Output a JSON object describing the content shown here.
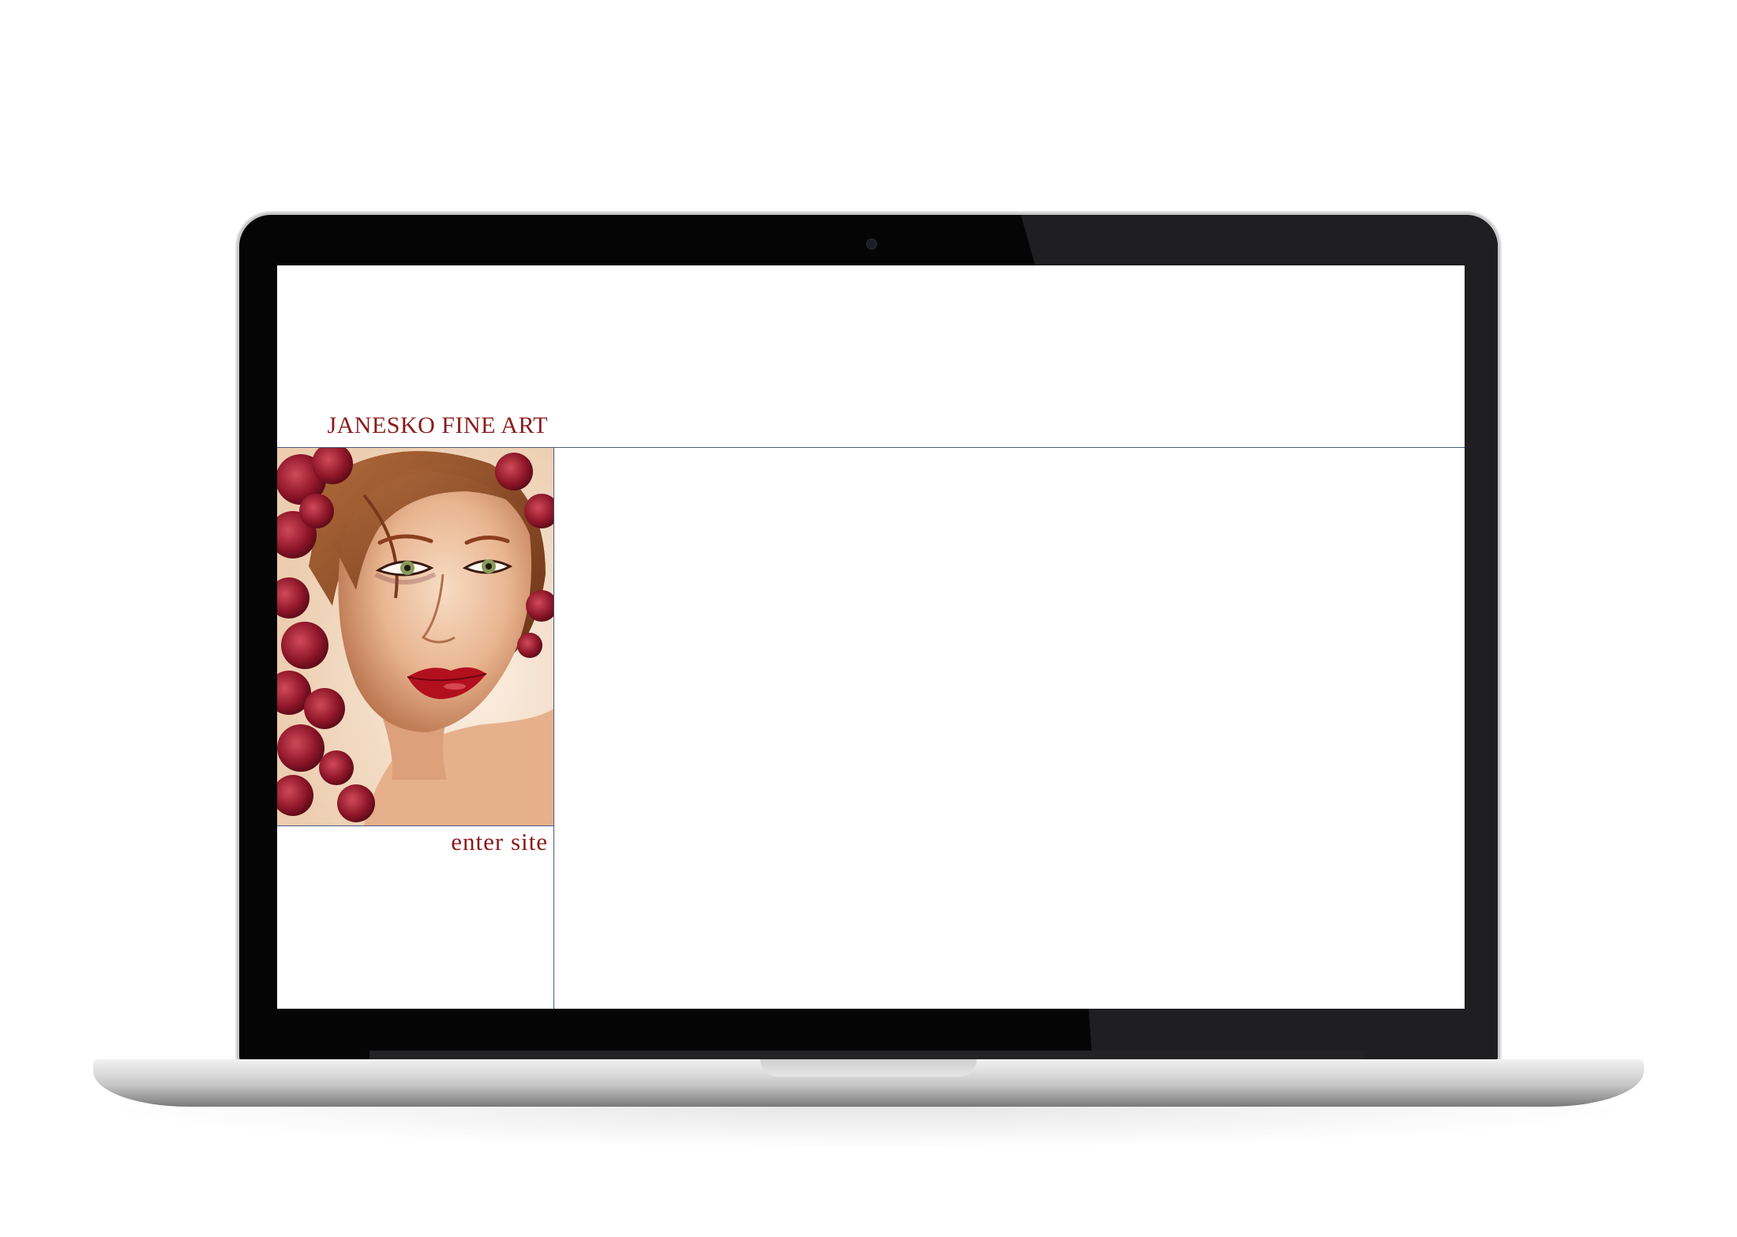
{
  "site": {
    "title": "JANESKO FINE ART",
    "enter_label": "enter site"
  },
  "colors": {
    "title_red": "#8b1a1a",
    "rule_blue": "#4a5a86",
    "screen_bg": "#ffffff"
  },
  "portrait": {
    "icon": "portrait-painting"
  }
}
